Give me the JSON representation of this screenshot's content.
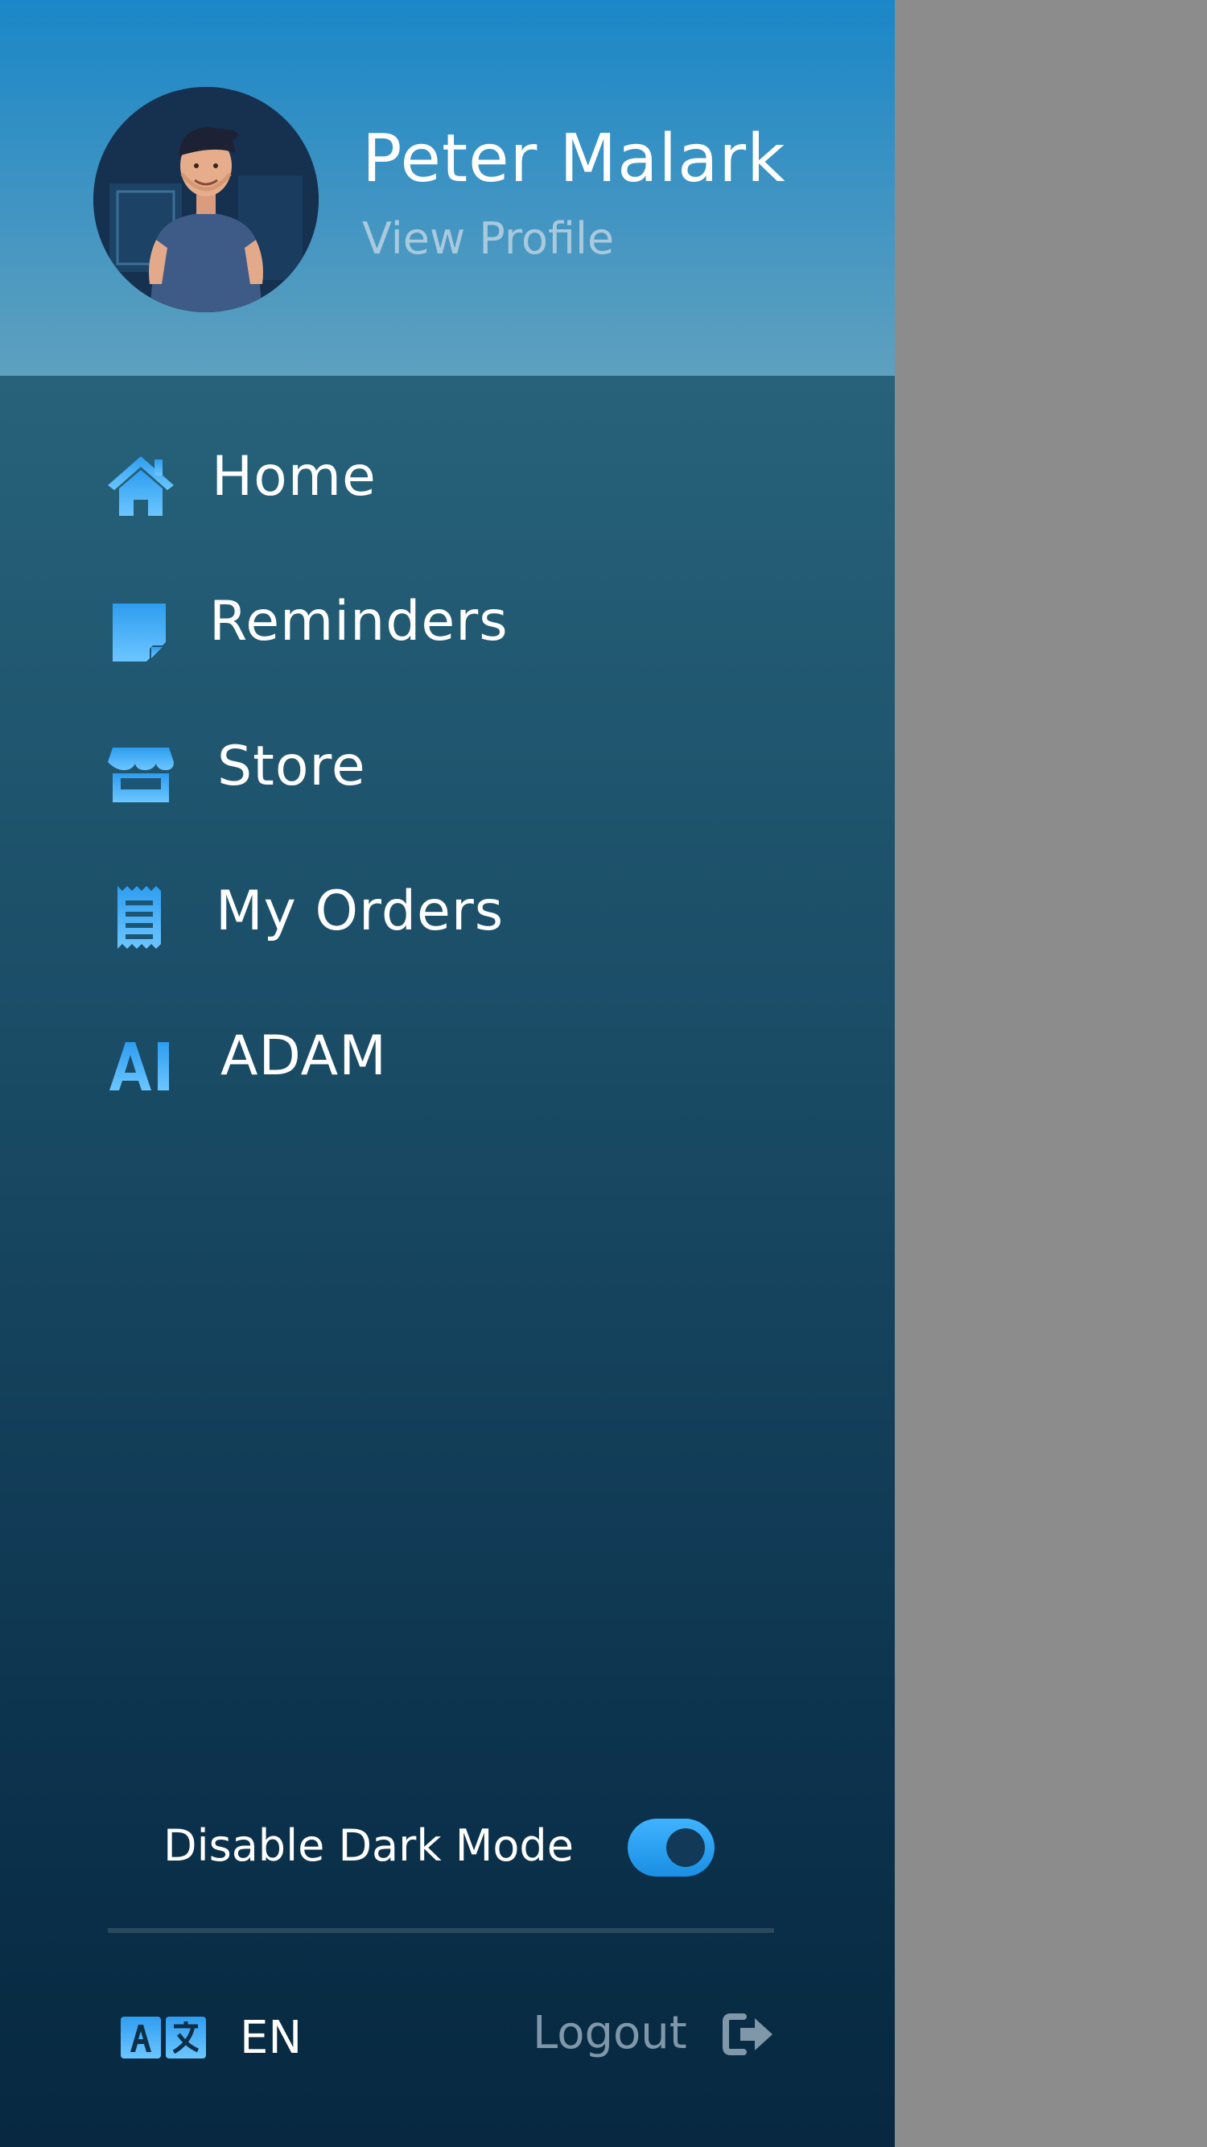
{
  "profile": {
    "name": "Peter Malark",
    "view_profile": "View Profile"
  },
  "menu": {
    "items": [
      {
        "label": "Home",
        "icon": "home-icon"
      },
      {
        "label": "Reminders",
        "icon": "sticky-note-icon"
      },
      {
        "label": "Store",
        "icon": "store-icon"
      },
      {
        "label": "My Orders",
        "icon": "receipt-icon"
      },
      {
        "label": "ADAM",
        "icon": "ai-icon",
        "icon_text": "AI"
      }
    ]
  },
  "settings": {
    "dark_mode_label": "Disable Dark Mode",
    "dark_mode_on": true
  },
  "footer": {
    "language": "EN",
    "language_icon": "translate-icon",
    "logout_label": "Logout",
    "logout_icon": "logout-icon"
  },
  "colors": {
    "icon_accent": "#3fa9f5",
    "header_top": "#1a87c8",
    "drawer_bottom": "#072840",
    "overlay": "#8c8c8c",
    "muted_text": "#7f97a9"
  }
}
